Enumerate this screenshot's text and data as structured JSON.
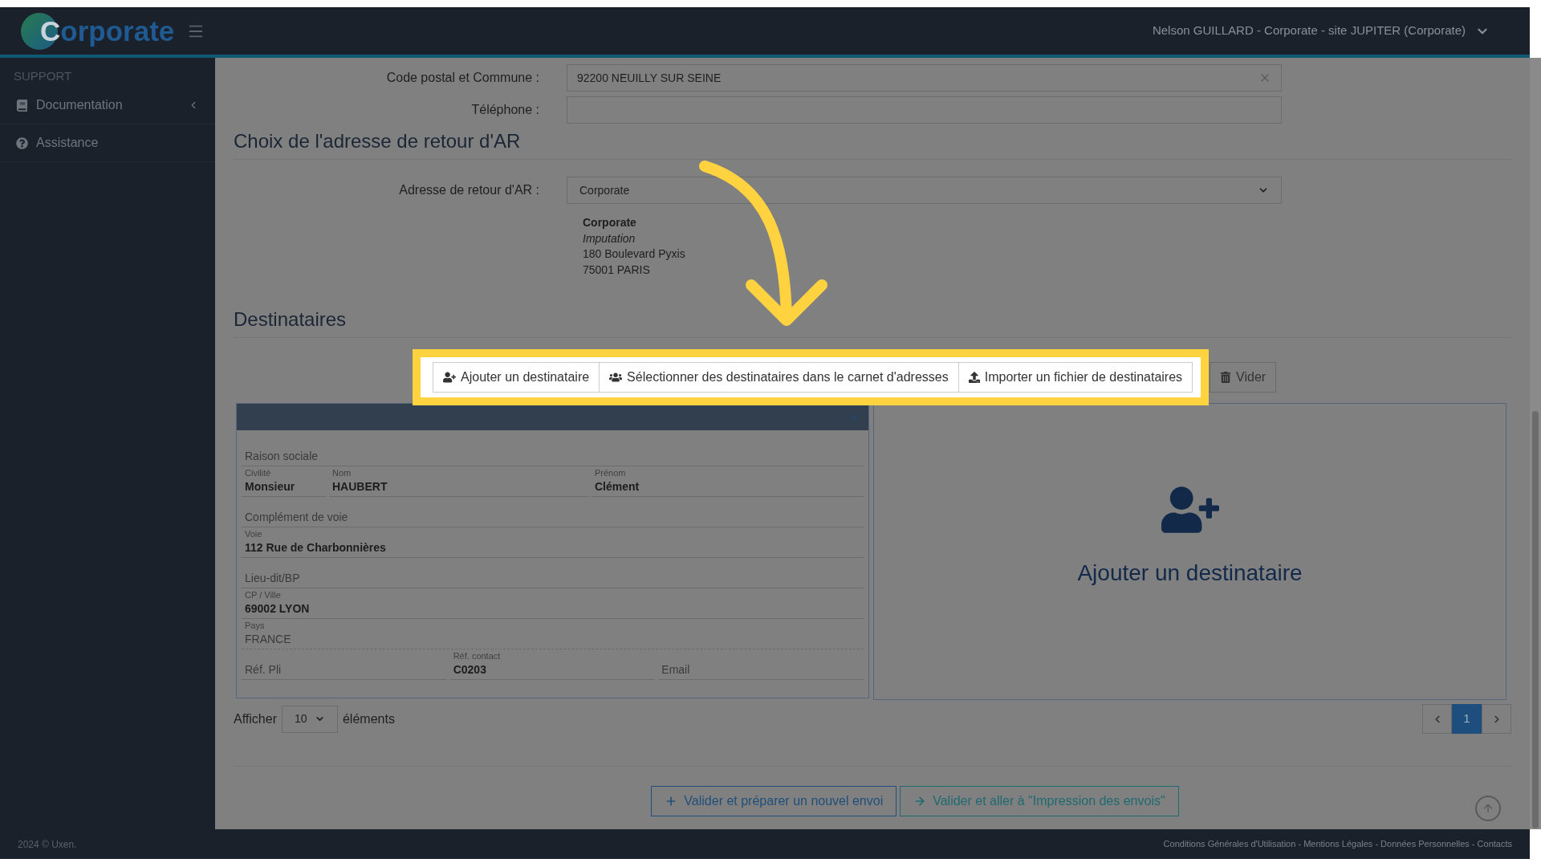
{
  "header": {
    "logo": "Corporate",
    "user": "Nelson GUILLARD - Corporate - site JUPITER (Corporate)"
  },
  "sidebar": {
    "section": "SUPPORT",
    "items": [
      {
        "label": "Documentation",
        "kind": "submenu"
      },
      {
        "label": "Assistance",
        "kind": "link"
      }
    ]
  },
  "sender_fields": [
    {
      "label": "Code postal et Commune :",
      "value": "92200 NEUILLY SUR SEINE",
      "kind": "clearable"
    },
    {
      "label": "Téléphone :",
      "kind": "text"
    }
  ],
  "return_address": {
    "heading": "Choix de l'adresse de retour d'AR",
    "label": "Adresse de retour d'AR :",
    "value": "Corporate",
    "lines": [
      {
        "text": "Corporate",
        "kind": "name"
      },
      {
        "text": "Imputation",
        "kind": "service"
      },
      {
        "text": "180 Boulevard Pyxis",
        "kind": "line"
      },
      {
        "text": "75001 PARIS",
        "kind": "line"
      }
    ]
  },
  "recipients": {
    "heading": "Destinataires",
    "toolbar": [
      {
        "label": "Ajouter un destinataire",
        "highlighted": true
      },
      {
        "label": "Sélectionner des destinataires dans le carnet d'adresses",
        "highlighted": true
      },
      {
        "label": "Importer un fichier de destinataires",
        "highlighted": true
      },
      {
        "label": "Vider",
        "highlighted": false
      }
    ],
    "card": {
      "rows": [
        {
          "kind": "single",
          "fields": [
            {
              "placeholder": "Raison sociale"
            }
          ]
        },
        {
          "kind": "names",
          "fields": [
            {
              "label": "Civilité",
              "value": "Monsieur"
            },
            {
              "label": "Nom",
              "value": "HAUBERT"
            },
            {
              "label": "Prénom",
              "value": "Clément"
            }
          ]
        },
        {
          "kind": "single",
          "fields": [
            {
              "placeholder": "Complément de voie"
            }
          ]
        },
        {
          "kind": "single",
          "fields": [
            {
              "label": "Voie",
              "value": "112 Rue de Charbonnières"
            }
          ]
        },
        {
          "kind": "single",
          "fields": [
            {
              "placeholder": "Lieu-dit/BP"
            }
          ]
        },
        {
          "kind": "single",
          "fields": [
            {
              "label": "CP / Ville",
              "value": "69002 LYON"
            }
          ]
        },
        {
          "kind": "single",
          "fields": [
            {
              "label": "Pays",
              "value": "FRANCE",
              "disabled": true
            }
          ]
        },
        {
          "kind": "refs",
          "fields": [
            {
              "placeholder": "Réf. Pli"
            },
            {
              "label": "Réf. contact",
              "value": "C0203"
            },
            {
              "placeholder": "Email"
            }
          ]
        }
      ]
    },
    "add_panel": {
      "label": "Ajouter un destinataire"
    }
  },
  "page_size": {
    "label": "Afficher",
    "value": "10",
    "suffix": "éléments"
  },
  "pagination": [
    {
      "label": "1",
      "selected": true
    }
  ],
  "actions": [
    {
      "label": "Valider et préparer un nouvel envoi",
      "kind": "new"
    },
    {
      "label": "Valider et aller à \"Impression des envois\"",
      "kind": "next"
    }
  ],
  "footer": {
    "copyright": "2024 © Uxen.",
    "links": "Conditions Générales d'Utilisation - Mentions Légales - Données Personnelles - Contacts"
  }
}
